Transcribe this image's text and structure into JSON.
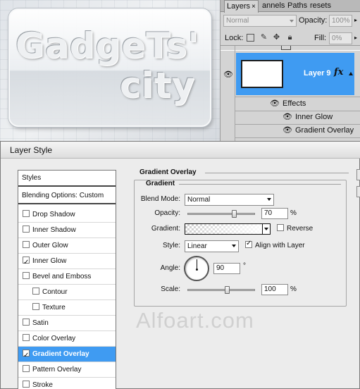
{
  "canvas": {
    "logo_line1": "GadgeTs'",
    "logo_line2": "city"
  },
  "layers_panel": {
    "tabs": [
      {
        "label": "Layers",
        "close": "×"
      },
      {
        "label": "annels"
      },
      {
        "label": "Paths"
      },
      {
        "label": "resets"
      }
    ],
    "blend_mode": "Normal",
    "opacity_label": "Opacity:",
    "opacity_value": "100%",
    "lock_label": "Lock:",
    "fill_label": "Fill:",
    "fill_value": "0%",
    "layer_name": "Layer 9",
    "fx_label": "fx",
    "effects_label": "Effects",
    "effect_items": [
      "Inner Glow",
      "Gradient Overlay"
    ]
  },
  "dialog": {
    "title": "Layer Style",
    "styles_list": {
      "header": "Styles",
      "blending": "Blending Options: Custom",
      "items": [
        {
          "label": "Drop Shadow",
          "checked": false
        },
        {
          "label": "Inner Shadow",
          "checked": false
        },
        {
          "label": "Outer Glow",
          "checked": false
        },
        {
          "label": "Inner Glow",
          "checked": true
        },
        {
          "label": "Bevel and Emboss",
          "checked": false
        },
        {
          "label": "Contour",
          "checked": false,
          "indent": true
        },
        {
          "label": "Texture",
          "checked": false,
          "indent": true
        },
        {
          "label": "Satin",
          "checked": false
        },
        {
          "label": "Color Overlay",
          "checked": false
        },
        {
          "label": "Gradient Overlay",
          "checked": true,
          "selected": true
        },
        {
          "label": "Pattern Overlay",
          "checked": false
        },
        {
          "label": "Stroke",
          "checked": false
        }
      ]
    },
    "section_title": "Gradient Overlay",
    "group_title": "Gradient",
    "blend_mode_label": "Blend Mode:",
    "blend_mode_value": "Normal",
    "opacity_label": "Opacity:",
    "opacity_value": "70",
    "opacity_unit": "%",
    "opacity_level": 0.7,
    "gradient_label": "Gradient:",
    "reverse_label": "Reverse",
    "reverse_checked": false,
    "style_label": "Style:",
    "style_value": "Linear",
    "align_label": "Align with Layer",
    "align_checked": true,
    "angle_label": "Angle:",
    "angle_value": "90",
    "angle_unit": "°",
    "scale_label": "Scale:",
    "scale_value": "100",
    "scale_unit": "%",
    "scale_level": 0.6
  },
  "watermark": "Alfoart.com"
}
